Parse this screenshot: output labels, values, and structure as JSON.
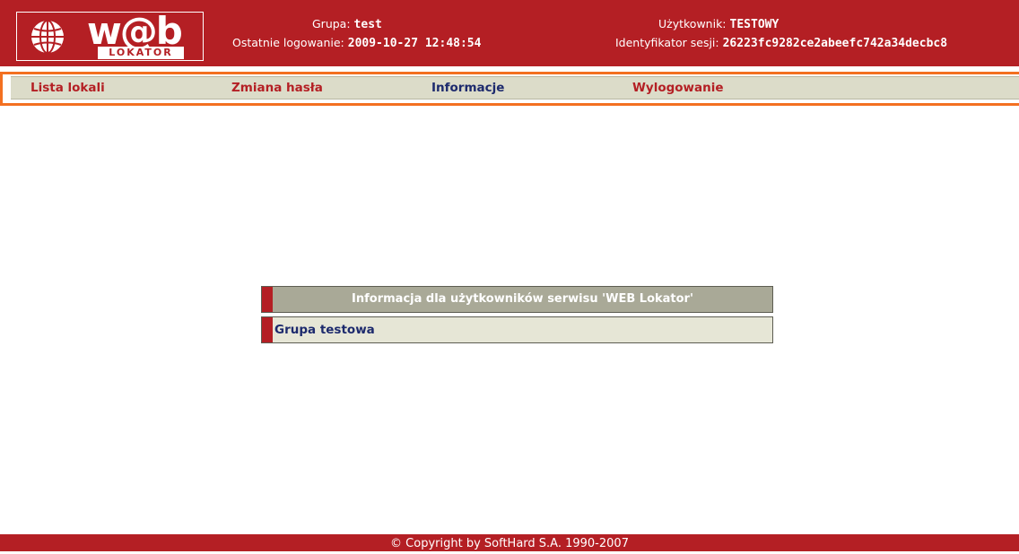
{
  "header": {
    "logo": {
      "word": "w@b",
      "sub": "LOKATOR"
    },
    "group_label": "Grupa:",
    "group_value": "test",
    "last_login_label": "Ostatnie logowanie:",
    "last_login_value": "2009-10-27 12:48:54",
    "user_label": "Użytkownik:",
    "user_value": "TESTOWY",
    "session_label": "Identyfikator sesji:",
    "session_value": "26223fc9282ce2abeefc742a34decbc8"
  },
  "nav": {
    "items": [
      {
        "label": "Lista lokali",
        "color": "#b41f24"
      },
      {
        "label": "Zmiana hasła",
        "color": "#b41f24"
      },
      {
        "label": "Informacje",
        "color": "#1d2a6d"
      },
      {
        "label": "Wylogowanie",
        "color": "#b41f24"
      }
    ],
    "highlight_color": "#f37021"
  },
  "info": {
    "title": "Informacja dla użytkowników serwisu 'WEB Lokator'",
    "body": "Grupa testowa"
  },
  "footer": {
    "copyright": "© Copyright by SoftHard S.A. 1990-2007"
  },
  "colors": {
    "brand_red": "#b41f24",
    "nav_bg": "#dcdcc9",
    "info_title_bg": "#a9a997"
  },
  "icons": {
    "logo_globe": "globe-icon"
  }
}
